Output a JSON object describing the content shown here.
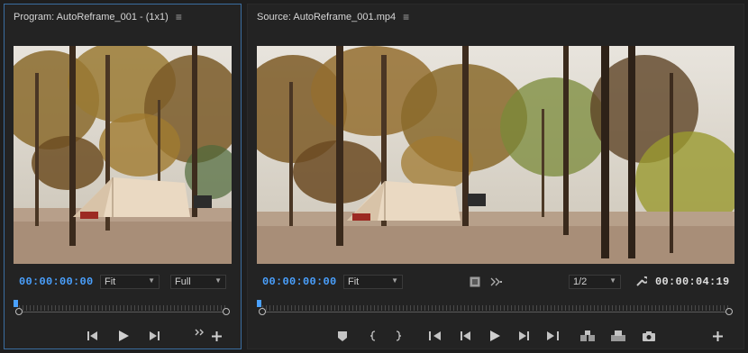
{
  "program": {
    "title": "Program: AutoReframe_001 - (1x1)",
    "menu_icon": "hamburger-icon",
    "timecode": "00:00:00:00",
    "zoom": "Fit",
    "resolution": "Full",
    "playhead_fraction": 0.0
  },
  "source": {
    "title": "Source: AutoReframe_001.mp4",
    "menu_icon": "hamburger-icon",
    "timecode_in": "00:00:00:00",
    "zoom": "Fit",
    "resolution": "1/2",
    "timecode_out": "00:00:04:19",
    "playhead_fraction": 0.0
  },
  "colors": {
    "accent": "#4aa1ff",
    "panel_bg": "#232323",
    "active_border": "#3b6ea0"
  },
  "icons": {
    "program_buttons": [
      "step-back-icon",
      "play-icon",
      "step-forward-icon",
      "extend-icon",
      "add-button-icon"
    ],
    "source_buttons": [
      "marker-icon",
      "mark-in-icon",
      "mark-out-icon",
      "go-to-in-icon",
      "step-back-icon",
      "play-icon",
      "step-forward-icon",
      "go-to-out-icon",
      "insert-icon",
      "overwrite-icon",
      "export-frame-icon",
      "add-button-icon"
    ],
    "source_toolbar": [
      "safe-margins-icon",
      "drag-video-audio-icon",
      "settings-wrench-icon"
    ]
  }
}
